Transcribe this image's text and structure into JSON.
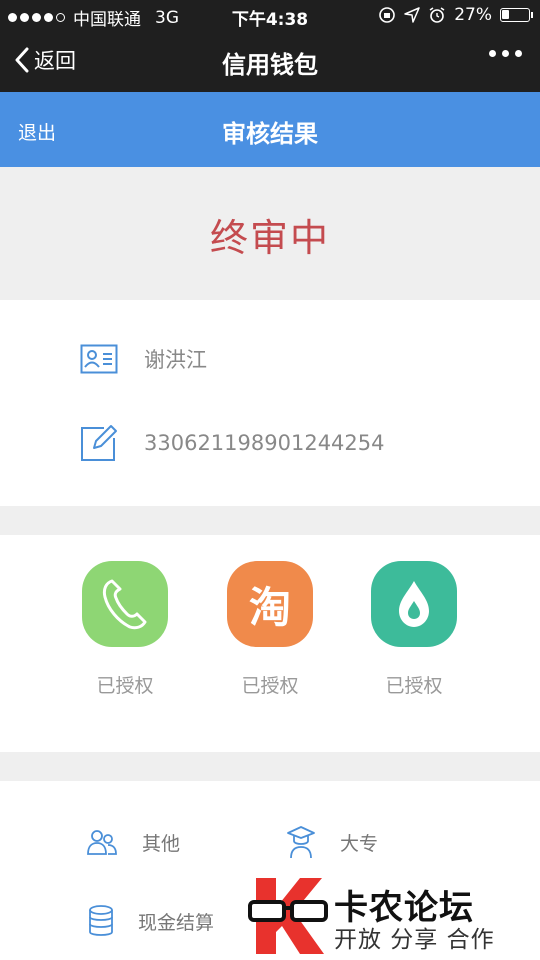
{
  "status_bar": {
    "carrier": "中国联通",
    "network": "3G",
    "time": "下午4:38",
    "battery": "27%",
    "battery_level": 0.27
  },
  "nav": {
    "back_label": "返回",
    "title": "信用钱包"
  },
  "header": {
    "exit_label": "退出",
    "title": "审核结果"
  },
  "review_status": "终审中",
  "identity": {
    "name": "谢洪江",
    "id_number": "330621198901244254"
  },
  "authorizations": [
    {
      "service": "phone",
      "icon": "phone-icon",
      "label": "已授权",
      "color": "#8ed674"
    },
    {
      "service": "taobao",
      "icon": "taobao-icon",
      "glyph": "淘",
      "label": "已授权",
      "color": "#f08a4b"
    },
    {
      "service": "other",
      "icon": "drop-icon",
      "label": "已授权",
      "color": "#3dbb9a"
    }
  ],
  "info": [
    {
      "icon": "people-icon",
      "label": "其他"
    },
    {
      "icon": "graduation-icon",
      "label": "大专"
    },
    {
      "icon": "database-icon",
      "label": "现金结算"
    }
  ],
  "watermark": {
    "line1": "卡农论坛",
    "line2": "开放 分享 合作"
  },
  "colors": {
    "accent": "#4a90e2",
    "status_red": "#c44b4f",
    "icon_blue": "#4a8fd8"
  }
}
